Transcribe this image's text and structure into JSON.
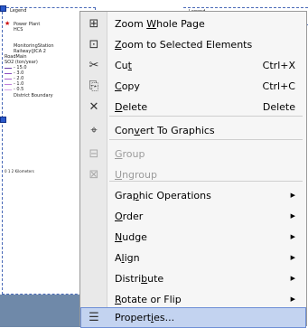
{
  "canvas": {
    "legend_title": "Legend",
    "legend_items": [
      "Power Plant",
      "HCS",
      "MonitoringStation",
      "Railway(JICA 2",
      "RoadMain",
      "SO2 (ton/year)",
      "- 15.0",
      "- 3.0",
      "- 2.0",
      "- 1.0",
      "- 0.5",
      "District Boundary"
    ],
    "scale_text": "0 1 2 Kilometers",
    "right_title": "Legend"
  },
  "menu": {
    "items": [
      {
        "icon": "zoom-whole-page-icon",
        "glyph": "⊞",
        "pre": "Zoom ",
        "u": "W",
        "post": "hole Page",
        "shortcut": "",
        "arrow": false,
        "disabled": false
      },
      {
        "icon": "zoom-selected-icon",
        "glyph": "⊡",
        "pre": "",
        "u": "Z",
        "post": "oom to Selected Elements",
        "shortcut": "",
        "arrow": false,
        "disabled": false
      },
      {
        "icon": "cut-icon",
        "glyph": "✂",
        "pre": "Cu",
        "u": "t",
        "post": "",
        "shortcut": "Ctrl+X",
        "arrow": false,
        "disabled": false
      },
      {
        "icon": "copy-icon",
        "glyph": "⎘",
        "pre": "",
        "u": "C",
        "post": "opy",
        "shortcut": "Ctrl+C",
        "arrow": false,
        "disabled": false
      },
      {
        "icon": "delete-icon",
        "glyph": "✕",
        "pre": "",
        "u": "D",
        "post": "elete",
        "shortcut": "Delete",
        "arrow": false,
        "disabled": false
      },
      {
        "icon": "convert-to-graphics-icon",
        "glyph": "⌖",
        "pre": "Con",
        "u": "v",
        "post": "ert To Graphics",
        "shortcut": "",
        "arrow": false,
        "disabled": false
      },
      {
        "icon": "group-icon",
        "glyph": "⊟",
        "pre": "",
        "u": "G",
        "post": "roup",
        "shortcut": "",
        "arrow": false,
        "disabled": true
      },
      {
        "icon": "ungroup-icon",
        "glyph": "⊠",
        "pre": "",
        "u": "U",
        "post": "ngroup",
        "shortcut": "",
        "arrow": false,
        "disabled": true
      },
      {
        "icon": "",
        "glyph": "",
        "pre": "Gra",
        "u": "p",
        "post": "hic Operations",
        "shortcut": "",
        "arrow": true,
        "disabled": false
      },
      {
        "icon": "",
        "glyph": "",
        "pre": "",
        "u": "O",
        "post": "rder",
        "shortcut": "",
        "arrow": true,
        "disabled": false
      },
      {
        "icon": "",
        "glyph": "",
        "pre": "",
        "u": "N",
        "post": "udge",
        "shortcut": "",
        "arrow": true,
        "disabled": false
      },
      {
        "icon": "",
        "glyph": "",
        "pre": "A",
        "u": "l",
        "post": "ign",
        "shortcut": "",
        "arrow": true,
        "disabled": false
      },
      {
        "icon": "",
        "glyph": "",
        "pre": "Distri",
        "u": "b",
        "post": "ute",
        "shortcut": "",
        "arrow": true,
        "disabled": false
      },
      {
        "icon": "",
        "glyph": "",
        "pre": "",
        "u": "R",
        "post": "otate or Flip",
        "shortcut": "",
        "arrow": true,
        "disabled": false
      },
      {
        "icon": "properties-icon",
        "glyph": "☰",
        "pre": "Propert",
        "u": "i",
        "post": "es...",
        "shortcut": "",
        "arrow": false,
        "disabled": false,
        "highlighted": true
      }
    ],
    "arrow_glyph": "▶"
  }
}
